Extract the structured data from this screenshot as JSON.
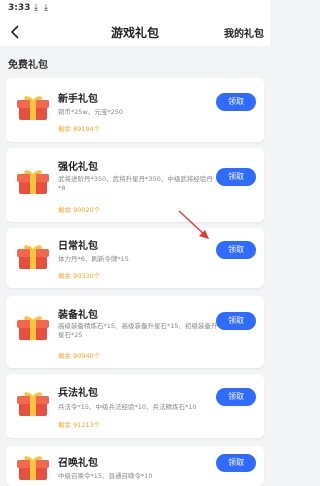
{
  "status": {
    "time": "3:33",
    "download_icons": [
      "download-icon",
      "download-icon"
    ]
  },
  "header": {
    "title": "游戏礼包",
    "my_gifts": "我的礼包"
  },
  "section": {
    "title": "免费礼包"
  },
  "button_label": "领取",
  "colors": {
    "accent": "#2f6bff",
    "remain": "#f5a623",
    "background": "#f3f4f6"
  },
  "gifts": [
    {
      "name": "新手礼包",
      "desc": "铜币*25w、元宝*250",
      "remain": "剩余 89194个"
    },
    {
      "name": "强化礼包",
      "desc": "武将进阶丹*350、武将升星丹*350、中级武将经验丹*8",
      "remain": "剩余 90020个"
    },
    {
      "name": "日常礼包",
      "desc": "体力丹*6、刷新令牌*15",
      "remain": "剩余 90330个"
    },
    {
      "name": "装备礼包",
      "desc": "高级装备精炼石*15、高级装备升星石*15、初级装备升星石*25",
      "remain": "剩余 90940个"
    },
    {
      "name": "兵法礼包",
      "desc": "兵法令*15、中级兵法经验*10、兵法精炼石*10",
      "remain": "剩余 91213个"
    },
    {
      "name": "召唤礼包",
      "desc": "中级召唤令*15、普通召唤令*10",
      "remain": ""
    }
  ]
}
